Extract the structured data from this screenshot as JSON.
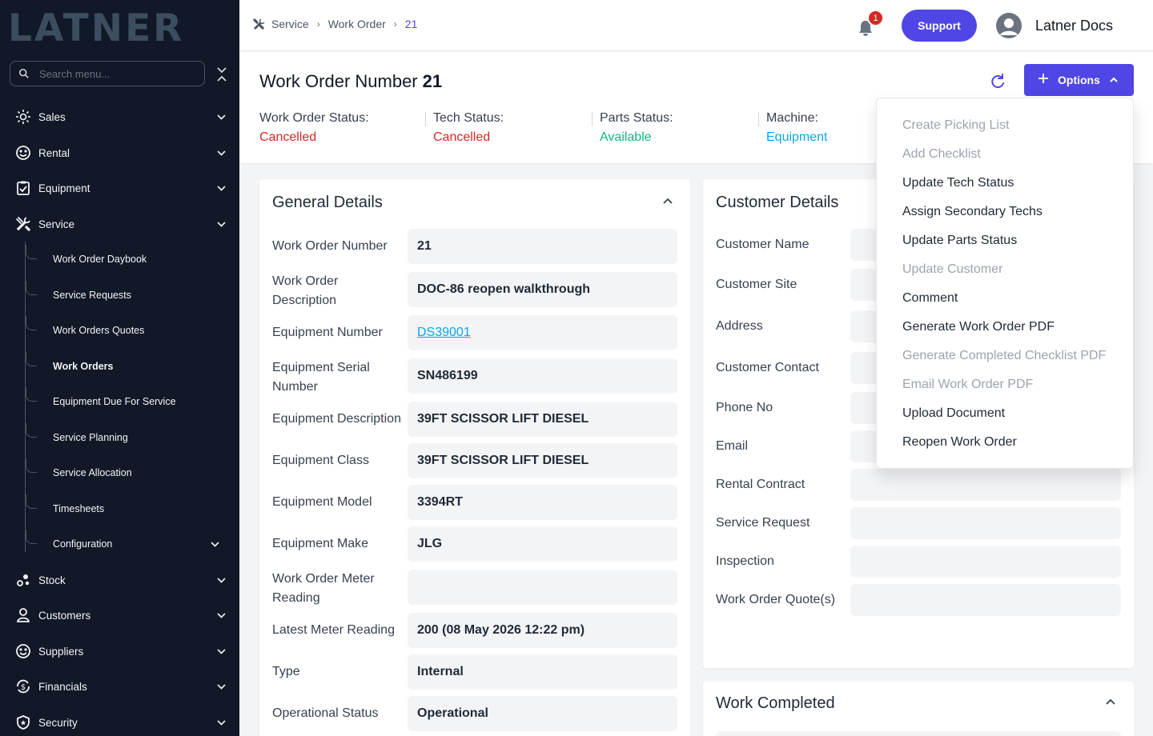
{
  "sidebar": {
    "logo": "LATNER",
    "search_placeholder": "Search menu...",
    "items": [
      {
        "label": "Sales",
        "icon": "sun-icon"
      },
      {
        "label": "Rental",
        "icon": "rental-icon"
      },
      {
        "label": "Equipment",
        "icon": "clipboard-icon"
      },
      {
        "label": "Service",
        "icon": "tools-icon"
      },
      {
        "label": "Stock",
        "icon": "stock-icon"
      },
      {
        "label": "Customers",
        "icon": "user-icon"
      },
      {
        "label": "Suppliers",
        "icon": "supplier-icon"
      },
      {
        "label": "Financials",
        "icon": "dollar-cycle-icon"
      },
      {
        "label": "Security",
        "icon": "shield-icon"
      }
    ],
    "service_subitems": [
      {
        "label": "Work Order Daybook"
      },
      {
        "label": "Service Requests"
      },
      {
        "label": "Work Orders Quotes"
      },
      {
        "label": "Work Orders",
        "active": true
      },
      {
        "label": "Equipment Due For Service"
      },
      {
        "label": "Service Planning"
      },
      {
        "label": "Service Allocation"
      },
      {
        "label": "Timesheets"
      },
      {
        "label": "Configuration"
      }
    ]
  },
  "topbar": {
    "breadcrumb": [
      "Service",
      "Work Order",
      "21"
    ],
    "notification_count": "1",
    "support_label": "Support",
    "user_name": "Latner Docs"
  },
  "header": {
    "title_label": "Work Order Number",
    "title_number": "21",
    "options_label": "Options",
    "statuses": [
      {
        "label": "Work Order Status:",
        "value": "Cancelled",
        "color": "#dc2626"
      },
      {
        "label": "Tech Status:",
        "value": "Cancelled",
        "color": "#dc2626"
      },
      {
        "label": "Parts Status:",
        "value": "Available",
        "color": "#10b981"
      },
      {
        "label": "Machine:",
        "value": "Equipment",
        "color": "#0ea5e9"
      }
    ]
  },
  "general_details": {
    "title": "General Details",
    "fields": [
      {
        "label": "Work Order Number",
        "value": "21"
      },
      {
        "label": "Work Order Description",
        "value": "DOC-86 reopen walkthrough"
      },
      {
        "label": "Equipment Number",
        "value": "DS39001",
        "link": true
      },
      {
        "label": "Equipment Serial Number",
        "value": "SN486199"
      },
      {
        "label": "Equipment Description",
        "value": "39FT SCISSOR LIFT DIESEL"
      },
      {
        "label": "Equipment Class",
        "value": "39FT SCISSOR LIFT DIESEL"
      },
      {
        "label": "Equipment Model",
        "value": "3394RT"
      },
      {
        "label": "Equipment Make",
        "value": "JLG"
      },
      {
        "label": "Work Order Meter Reading",
        "value": ""
      },
      {
        "label": "Latest Meter Reading",
        "value": "200 (08 May 2026 12:22 pm)"
      },
      {
        "label": "Type",
        "value": "Internal"
      },
      {
        "label": "Operational Status",
        "value": "Operational"
      }
    ]
  },
  "customer_details": {
    "title": "Customer Details",
    "fields": [
      {
        "label": "Customer Name"
      },
      {
        "label": "Customer Site"
      },
      {
        "label": "Address"
      },
      {
        "label": "Customer Contact"
      },
      {
        "label": "Phone No"
      },
      {
        "label": "Email"
      },
      {
        "label": "Rental Contract"
      },
      {
        "label": "Service Request"
      },
      {
        "label": "Inspection"
      },
      {
        "label": "Work Order Quote(s)"
      }
    ]
  },
  "work_completed": {
    "title": "Work Completed"
  },
  "options_menu": {
    "items": [
      {
        "label": "Create Picking List",
        "enabled": false
      },
      {
        "label": "Add Checklist",
        "enabled": false
      },
      {
        "label": "Update Tech Status",
        "enabled": true
      },
      {
        "label": "Assign Secondary Techs",
        "enabled": true
      },
      {
        "label": "Update Parts Status",
        "enabled": true
      },
      {
        "label": "Update Customer",
        "enabled": false
      },
      {
        "label": "Comment",
        "enabled": true
      },
      {
        "label": "Generate Work Order PDF",
        "enabled": true
      },
      {
        "label": "Generate Completed Checklist PDF",
        "enabled": false
      },
      {
        "label": "Email Work Order PDF",
        "enabled": false
      },
      {
        "label": "Upload Document",
        "enabled": true
      },
      {
        "label": "Reopen Work Order",
        "enabled": true
      }
    ]
  },
  "colors": {
    "accent": "#4f46e5",
    "sidebar_bg": "#111827",
    "danger": "#dc2626",
    "success": "#10b981",
    "link": "#0ea5e9"
  }
}
